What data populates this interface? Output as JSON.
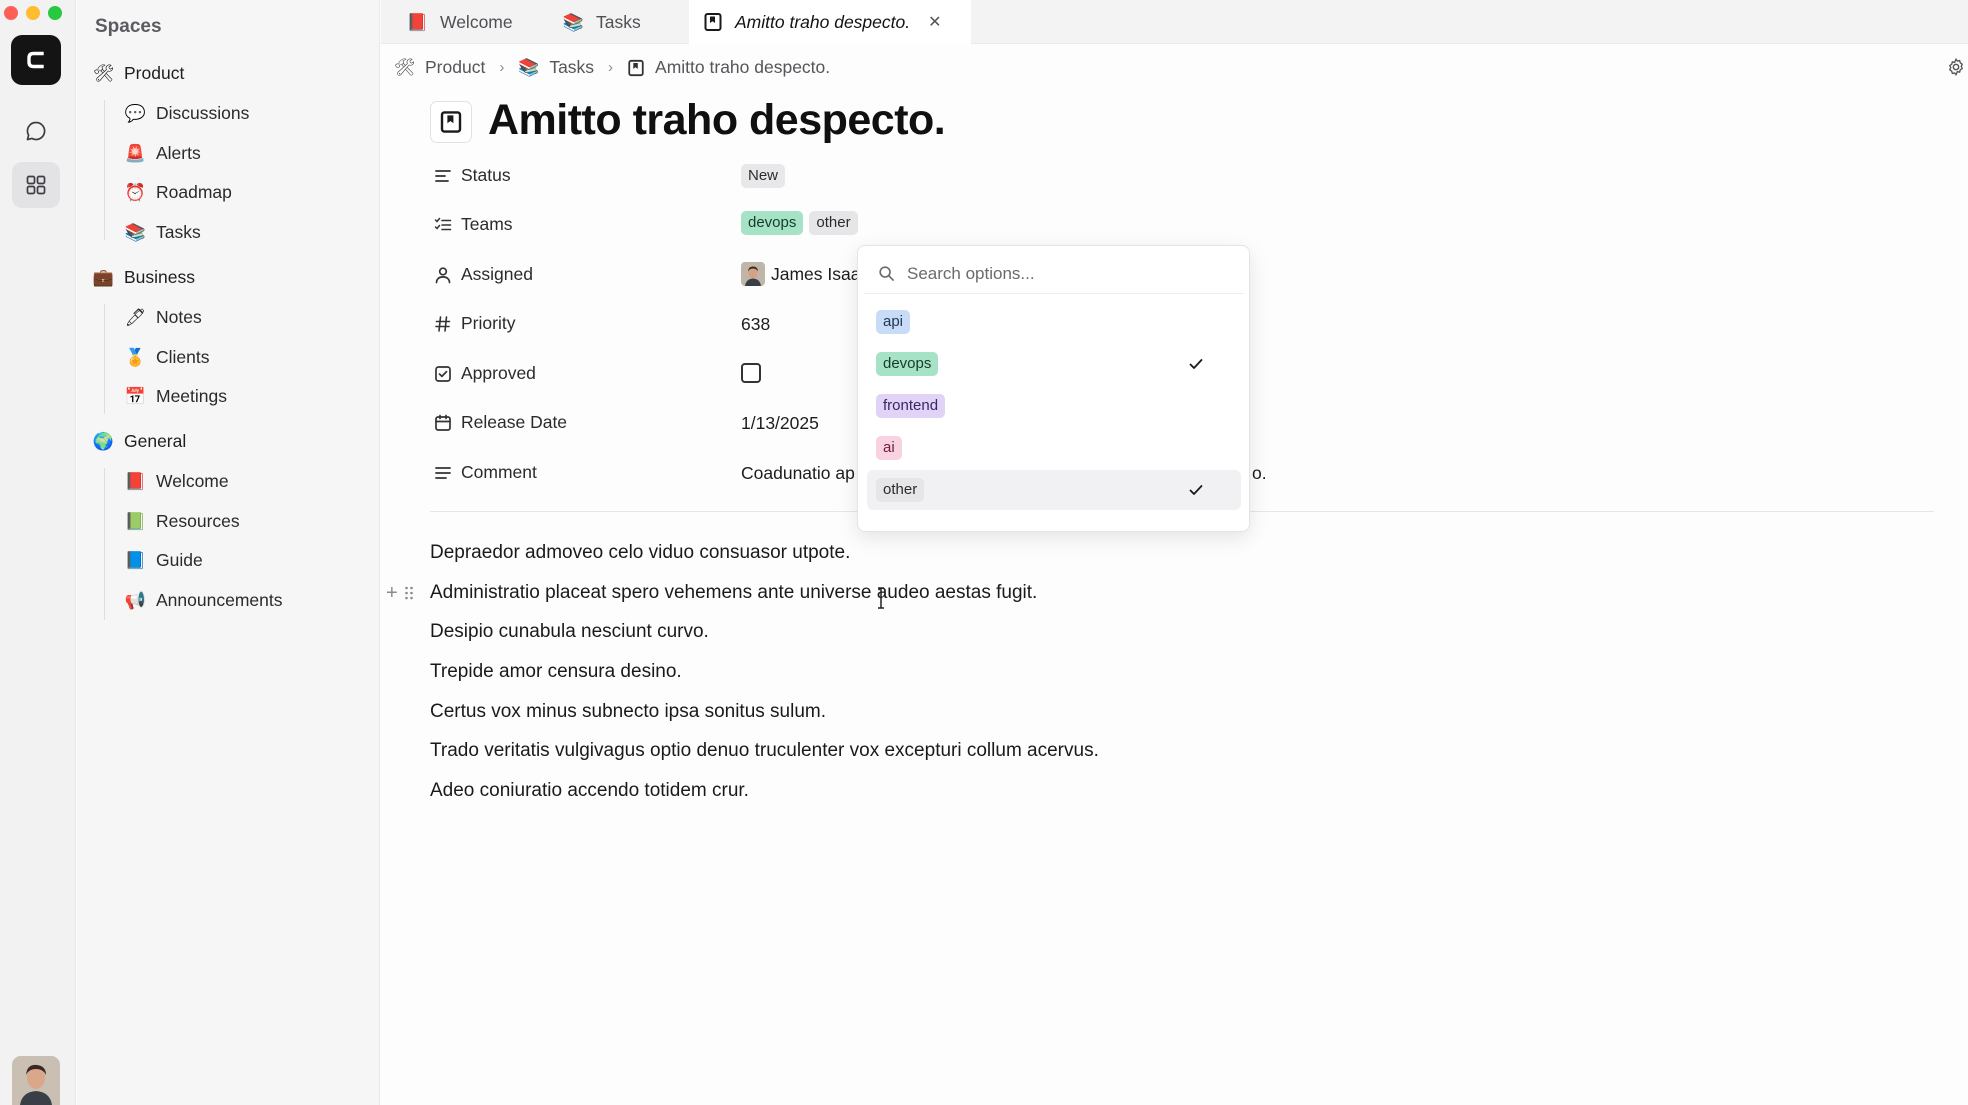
{
  "colors": {
    "traffic_red": "#fe5f57",
    "traffic_yellow": "#febc2e",
    "traffic_green": "#28c840",
    "tag_api_bg": "#c9dcf7",
    "tag_devops_bg": "#a6e3c6",
    "tag_frontend_bg": "#e0d3f6",
    "tag_ai_bg": "#f8d2e0",
    "tag_other_bg": "#e6e6e8",
    "tag_new_bg": "#e8e8ea"
  },
  "rail": {
    "logo_letter": "C",
    "chat_icon": "chat-bubble-icon",
    "spaces_icon": "grid-icon"
  },
  "sidebar": {
    "title": "Spaces",
    "groups": [
      {
        "label": "Product",
        "icon": "🛠",
        "items": [
          {
            "label": "Discussions",
            "icon": "💬"
          },
          {
            "label": "Alerts",
            "icon": "🚨"
          },
          {
            "label": "Roadmap",
            "icon": "⏰"
          },
          {
            "label": "Tasks",
            "icon": "📚"
          }
        ]
      },
      {
        "label": "Business",
        "icon": "💼",
        "items": [
          {
            "label": "Notes",
            "icon": "🖊"
          },
          {
            "label": "Clients",
            "icon": "🏅"
          },
          {
            "label": "Meetings",
            "icon": "📅"
          }
        ]
      },
      {
        "label": "General",
        "icon": "🌍",
        "items": [
          {
            "label": "Welcome",
            "icon": "📕"
          },
          {
            "label": "Resources",
            "icon": "📗"
          },
          {
            "label": "Guide",
            "icon": "📘"
          },
          {
            "label": "Announcements",
            "icon": "📢"
          }
        ]
      }
    ]
  },
  "tabs": [
    {
      "label": "Welcome",
      "icon": "📕"
    },
    {
      "label": "Tasks",
      "icon": "📚"
    },
    {
      "label": "Amitto traho despecto.",
      "icon": "bookmark-icon",
      "close": "✕"
    }
  ],
  "breadcrumb": [
    {
      "label": "Product",
      "icon": "🛠"
    },
    {
      "label": "Tasks",
      "icon": "📚"
    },
    {
      "label": "Amitto traho despecto.",
      "icon": "bookmark-icon"
    }
  ],
  "page": {
    "title": "Amitto traho despecto.",
    "properties": {
      "status": {
        "label": "Status",
        "value": "New"
      },
      "teams": {
        "label": "Teams",
        "values": [
          "devops",
          "other"
        ]
      },
      "assigned": {
        "label": "Assigned",
        "value": "James Isaa"
      },
      "priority": {
        "label": "Priority",
        "value": "638"
      },
      "approved": {
        "label": "Approved",
        "checked": false
      },
      "release_date": {
        "label": "Release Date",
        "value": "1/13/2025"
      },
      "comment": {
        "label": "Comment",
        "value": "Coadunatio ap",
        "tail": "o."
      }
    },
    "paragraphs": [
      "Depraedor admoveo celo viduo consuasor utpote.",
      "Administratio placeat spero vehemens ante universe audeo aestas fugit.",
      "Desipio cunabula nesciunt curvo.",
      "Trepide amor censura desino.",
      "Certus vox minus subnecto ipsa sonitus sulum.",
      "Trado veritatis vulgivagus optio denuo truculenter vox excepturi collum acervus.",
      "Adeo coniuratio accendo totidem crur."
    ]
  },
  "dropdown": {
    "search_placeholder": "Search options...",
    "options": [
      {
        "label": "api",
        "selected": false
      },
      {
        "label": "devops",
        "selected": true
      },
      {
        "label": "frontend",
        "selected": false
      },
      {
        "label": "ai",
        "selected": false
      },
      {
        "label": "other",
        "selected": true
      }
    ]
  }
}
